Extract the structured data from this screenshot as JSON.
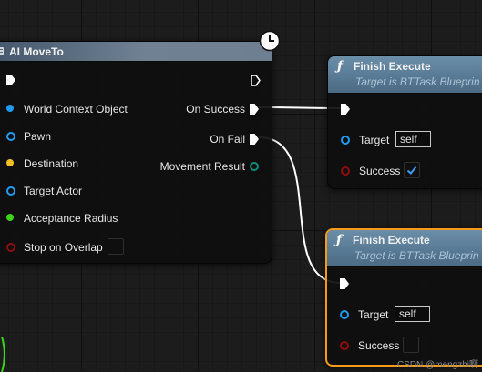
{
  "moveto": {
    "title": "AI MoveTo",
    "latent_icon": "clock-icon",
    "inputs": [
      {
        "label": "World Context Object",
        "color": "#1f9bf0",
        "style": "filled"
      },
      {
        "label": "Pawn",
        "color": "#1f9bf0",
        "style": "hollow"
      },
      {
        "label": "Destination",
        "color": "#f2c024",
        "style": "filled"
      },
      {
        "label": "Target Actor",
        "color": "#1f9bf0",
        "style": "hollow"
      },
      {
        "label": "Acceptance Radius",
        "color": "#3dd31a",
        "style": "filled"
      },
      {
        "label": "Stop on Overlap",
        "color": "#8e0c0c",
        "style": "hollow",
        "checked": false
      }
    ],
    "outputs": [
      {
        "label": "On Success"
      },
      {
        "label": "On Fail"
      },
      {
        "label": "Movement Result",
        "color": "#0e8e76"
      }
    ]
  },
  "finish_nodes": [
    {
      "title": "Finish Execute",
      "subtitle": "Target is BTTask Blueprin",
      "target_label": "Target",
      "target_value": "self",
      "success_label": "Success",
      "success_checked": true,
      "selected": false
    },
    {
      "title": "Finish Execute",
      "subtitle": "Target is BTTask Blueprin",
      "target_label": "Target",
      "target_value": "self",
      "success_label": "Success",
      "success_checked": false,
      "selected": true
    }
  ],
  "colors": {
    "exec": "#ffffff",
    "object_pin": "#1f9bf0",
    "bool_pin": "#8e0c0c",
    "selection": "#f59b18"
  },
  "watermark": "CSDN @mengzhi啊"
}
